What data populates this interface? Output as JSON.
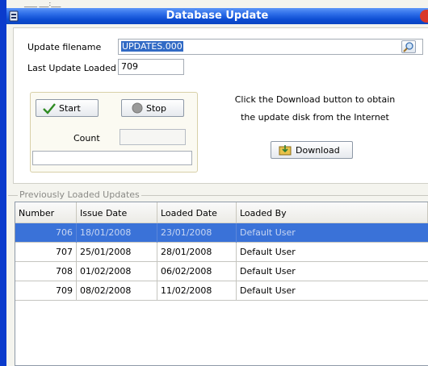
{
  "window": {
    "title": "Database Update",
    "top_fragment": "____ ___:___"
  },
  "form": {
    "filename_label": "Update filename",
    "filename_value": "UPDATES.000",
    "last_update_label": "Last Update Loaded",
    "last_update_value": "709",
    "start_label": "Start",
    "stop_label": "Stop",
    "count_label": "Count",
    "count_value": "",
    "status_value": "",
    "info_line1": "Click the Download button to obtain",
    "info_line2": "the update disk from the Internet",
    "download_label": "Download"
  },
  "updates": {
    "legend": "Previously Loaded Updates",
    "columns": [
      "Number",
      "Issue Date",
      "Loaded Date",
      "Loaded By"
    ],
    "rows": [
      {
        "number": "706",
        "issue": "18/01/2008",
        "loaded": "23/01/2008",
        "by": "Default User",
        "selected": true
      },
      {
        "number": "707",
        "issue": "25/01/2008",
        "loaded": "28/01/2008",
        "by": "Default User",
        "selected": false
      },
      {
        "number": "708",
        "issue": "01/02/2008",
        "loaded": "06/02/2008",
        "by": "Default User",
        "selected": false
      },
      {
        "number": "709",
        "issue": "08/02/2008",
        "loaded": "11/02/2008",
        "by": "Default User",
        "selected": false
      }
    ]
  },
  "colors": {
    "titlebar": "#0e4ed3",
    "selection": "#3a72d8"
  },
  "icons": [
    "window-icon",
    "close-icon",
    "search-icon",
    "checkmark-icon",
    "stop-icon",
    "download-icon"
  ]
}
